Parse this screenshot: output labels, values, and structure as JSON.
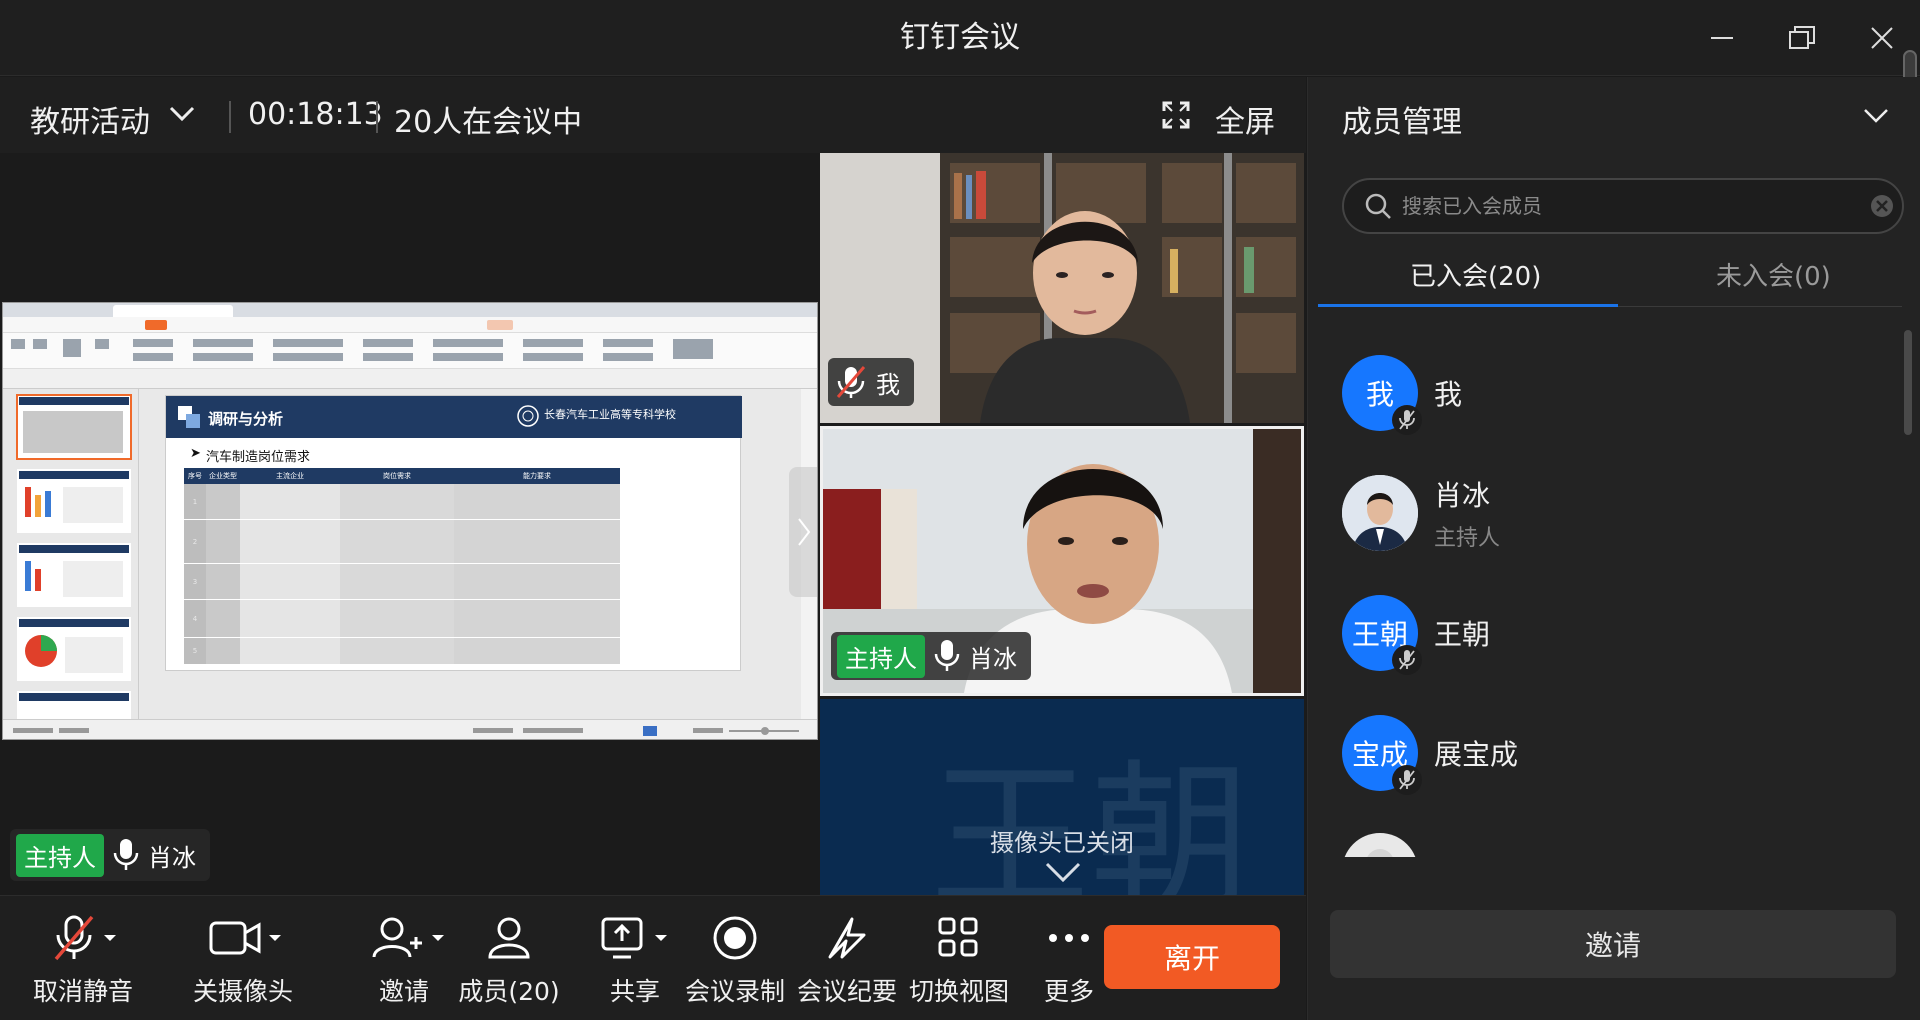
{
  "window": {
    "title": "钉钉会议"
  },
  "infobar": {
    "meeting_name": "教研活动",
    "elapsed": "00:18:13",
    "in_meeting": "20人在会议中",
    "fullscreen_label": "全屏"
  },
  "share": {
    "slide_title": "调研与分析",
    "school_name": "长春汽车工业高等专科学校",
    "section_heading": "汽车制造岗位需求",
    "table_headers": [
      "序号",
      "企业类型",
      "主流企业",
      "岗位需求",
      "能力要求"
    ],
    "row_numbers": [
      "1",
      "2",
      "3",
      "4",
      "5"
    ],
    "presenter_tag": "主持人",
    "presenter_name": "肖冰"
  },
  "tiles": {
    "me": {
      "name": "我"
    },
    "host": {
      "tag": "主持人",
      "name": "肖冰"
    },
    "camera_off": {
      "big_name": "王朝",
      "status": "摄像头已关闭"
    }
  },
  "toolbar": {
    "items": [
      {
        "label": "取消静音",
        "icon": "mic-muted-icon"
      },
      {
        "label": "关摄像头",
        "icon": "camera-icon"
      },
      {
        "label": "邀请",
        "icon": "add-user-icon"
      },
      {
        "label": "成员(20)",
        "icon": "members-icon"
      },
      {
        "label": "共享",
        "icon": "share-screen-icon"
      },
      {
        "label": "会议录制",
        "icon": "record-icon"
      },
      {
        "label": "会议纪要",
        "icon": "notes-icon"
      },
      {
        "label": "切换视图",
        "icon": "grid-view-icon"
      },
      {
        "label": "更多",
        "icon": "more-icon"
      }
    ],
    "leave_label": "离开"
  },
  "panel": {
    "title": "成员管理",
    "search_placeholder": "搜索已入会成员",
    "tab_joined": "已入会(20)",
    "tab_not_joined": "未入会(0)",
    "members": [
      {
        "avatar_text": "我",
        "name": "我",
        "role": ""
      },
      {
        "avatar_text": "",
        "name": "肖冰",
        "role": "主持人"
      },
      {
        "avatar_text": "王朝",
        "name": "王朝",
        "role": ""
      },
      {
        "avatar_text": "宝成",
        "name": "展宝成",
        "role": ""
      }
    ],
    "invite_label": "邀请"
  },
  "colors": {
    "accent": "#1677ff",
    "leave": "#f25a24",
    "host_tag": "#20a84a",
    "muted_red": "#e5483a"
  }
}
